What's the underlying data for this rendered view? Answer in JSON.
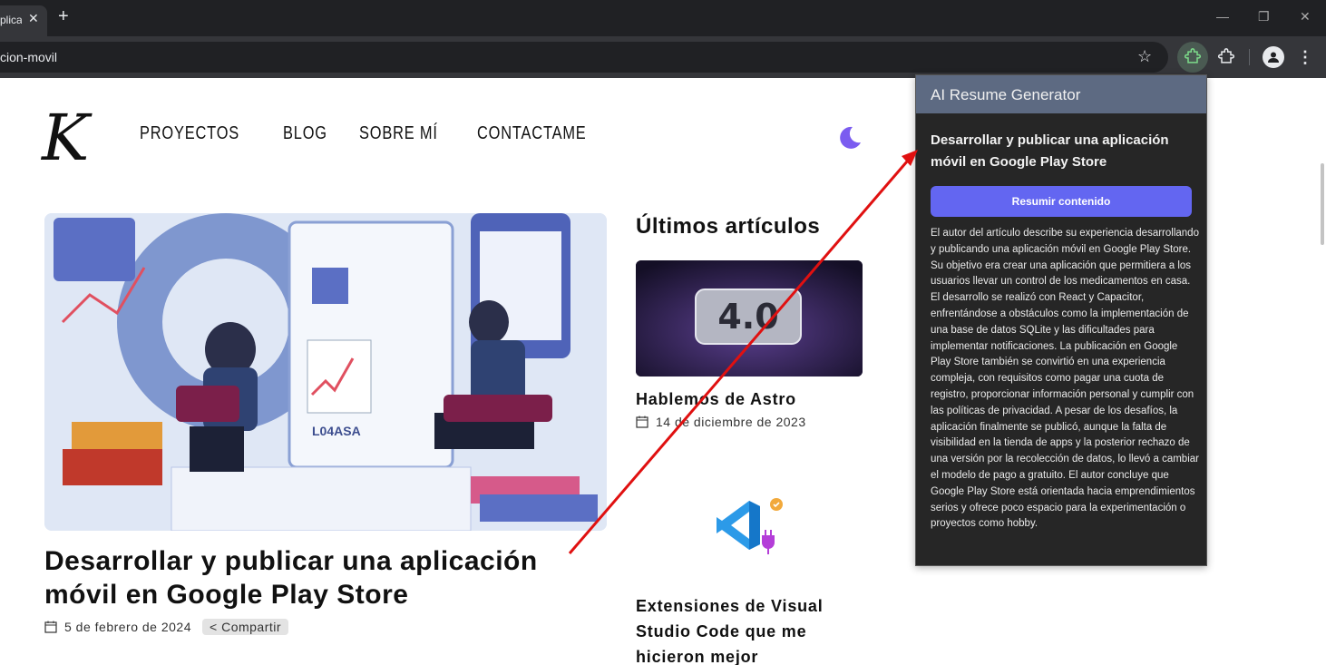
{
  "browser": {
    "tab_title": "plica",
    "url": "cion-movil"
  },
  "site": {
    "logo_letter": "K",
    "nav": [
      "PROYECTOS",
      "BLOG",
      "SOBRE MÍ",
      "CONTACTAME"
    ]
  },
  "main_post": {
    "title": "Desarrollar y publicar una aplicación móvil en Google Play Store",
    "date": "5 de febrero de 2024",
    "share_label": "Compartir"
  },
  "sidebar": {
    "heading": "Últimos artículos",
    "articles": [
      {
        "title": "Hablemos de Astro",
        "date": "14 de diciembre de 2023",
        "thumb_text": "4.0"
      },
      {
        "title": "Extensiones de Visual Studio Code que me hicieron mejor"
      }
    ]
  },
  "extension_popup": {
    "header": "AI Resume Generator",
    "article_title": "Desarrollar y publicar una aplicación móvil en Google Play Store",
    "button_label": "Resumir contenido",
    "summary": "El autor del artículo describe su experiencia desarrollando y publicando una aplicación móvil en Google Play Store. Su objetivo era crear una aplicación que permitiera a los usuarios llevar un control de los medicamentos en casa. El desarrollo se realizó con React y Capacitor, enfrentándose a obstáculos como la implementación de una base de datos SQLite y las dificultades para implementar notificaciones. La publicación en Google Play Store también se convirtió en una experiencia compleja, con requisitos como pagar una cuota de registro, proporcionar información personal y cumplir con las políticas de privacidad. A pesar de los desafíos, la aplicación finalmente se publicó, aunque la falta de visibilidad en la tienda de apps y la posterior rechazo de una versión por la recolección de datos, lo llevó a cambiar el modelo de pago a gratuito. El autor concluye que Google Play Store está orientada hacia emprendimientos serios y ofrece poco espacio para la experimentación o proyectos como hobby."
  },
  "colors": {
    "accent": "#6366f1",
    "popup_header": "#5d6a82",
    "annotation_arrow": "#e01010"
  },
  "icons": [
    "close-icon",
    "plus-icon",
    "star-icon",
    "puzzle-icon",
    "profile-icon",
    "more-vert-icon",
    "moon-icon",
    "calendar-icon",
    "share-icon",
    "vscode-icon"
  ]
}
